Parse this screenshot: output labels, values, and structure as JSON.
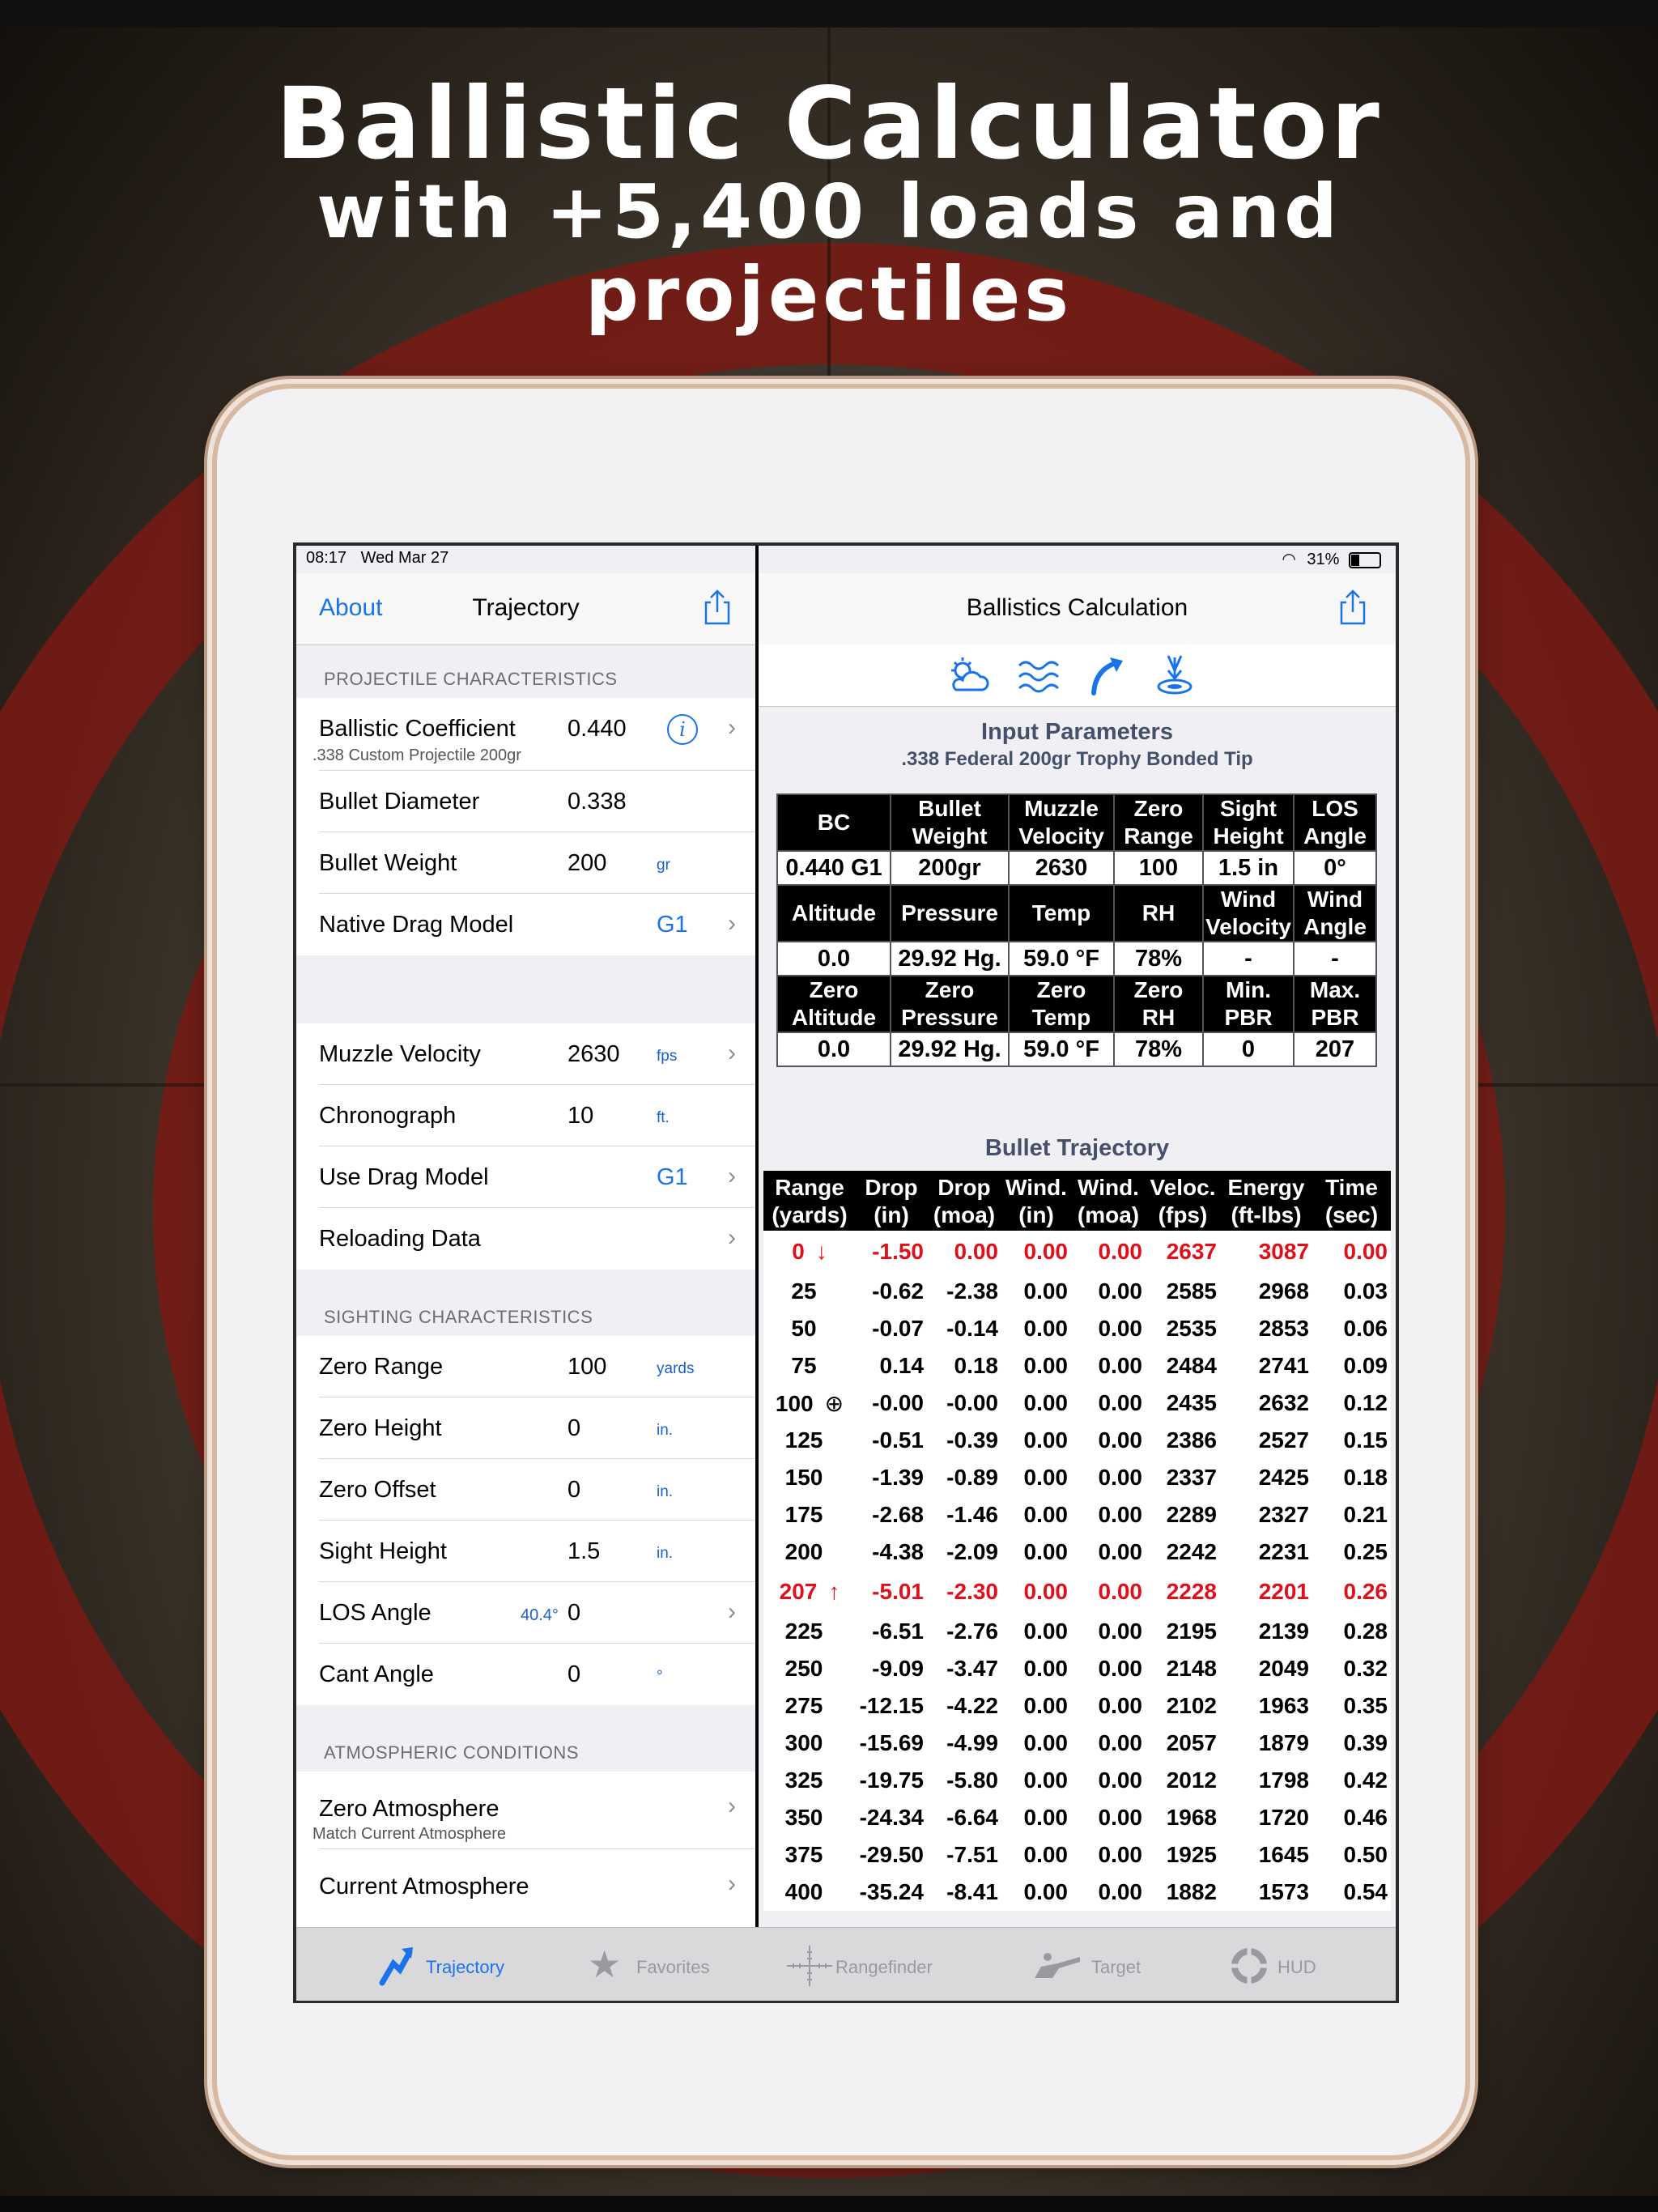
{
  "headline": {
    "line1": "Ballistic Calculator",
    "line2": "with +5,400 loads and",
    "line3": "projectiles"
  },
  "status": {
    "time": "08:17",
    "date": "Wed Mar 27",
    "battery": "31%"
  },
  "left_nav": {
    "back": "About",
    "title": "Trajectory"
  },
  "right_nav": {
    "title": "Ballistics Calculation"
  },
  "projectile": {
    "header": "PROJECTILE CHARACTERISTICS",
    "bc_label": "Ballistic Coefficient",
    "bc_value": "0.440",
    "bc_sub": ".338 Custom Projectile 200gr",
    "diameter_label": "Bullet Diameter",
    "diameter_value": "0.338",
    "weight_label": "Bullet Weight",
    "weight_value": "200",
    "weight_unit": "gr",
    "native_drag_label": "Native Drag Model",
    "native_drag_value": "G1",
    "muzzle_label": "Muzzle Velocity",
    "muzzle_value": "2630",
    "muzzle_unit": "fps",
    "chrono_label": "Chronograph",
    "chrono_value": "10",
    "chrono_unit": "ft.",
    "use_drag_label": "Use Drag Model",
    "use_drag_value": "G1",
    "reloading_label": "Reloading Data"
  },
  "sighting": {
    "header": "SIGHTING CHARACTERISTICS",
    "zero_range_label": "Zero Range",
    "zero_range_value": "100",
    "zero_range_unit": "yards",
    "zero_height_label": "Zero Height",
    "zero_height_value": "0",
    "zero_height_unit": "in.",
    "zero_offset_label": "Zero Offset",
    "zero_offset_value": "0",
    "zero_offset_unit": "in.",
    "sight_height_label": "Sight Height",
    "sight_height_value": "1.5",
    "sight_height_unit": "in.",
    "los_label": "LOS Angle",
    "los_hint": "40.4°",
    "los_value": "0",
    "cant_label": "Cant Angle",
    "cant_value": "0",
    "cant_unit": "°"
  },
  "atmo": {
    "header": "ATMOSPHERIC CONDITIONS",
    "zero_label": "Zero Atmosphere",
    "zero_sub": "Match Current Atmosphere",
    "current_label": "Current Atmosphere"
  },
  "input_params": {
    "title": "Input Parameters",
    "subtitle": ".338 Federal 200gr Trophy Bonded Tip",
    "row1_headers": [
      "BC",
      "Bullet Weight",
      "Muzzle Velocity",
      "Zero Range",
      "Sight Height",
      "LOS Angle"
    ],
    "row1_values": [
      "0.440 G1",
      "200gr",
      "2630",
      "100",
      "1.5 in",
      "0°"
    ],
    "row2_headers": [
      "Altitude",
      "Pressure",
      "Temp",
      "RH",
      "Wind Velocity",
      "Wind Angle"
    ],
    "row2_values": [
      "0.0",
      "29.92 Hg.",
      "59.0 °F",
      "78%",
      "-",
      "-"
    ],
    "row3_headers": [
      "Zero Altitude",
      "Zero Pressure",
      "Zero Temp",
      "Zero RH",
      "Min. PBR",
      "Max. PBR"
    ],
    "row3_values": [
      "0.0",
      "29.92 Hg.",
      "59.0 °F",
      "78%",
      "0",
      "207"
    ]
  },
  "trajectory": {
    "title": "Bullet Trajectory",
    "headers": [
      "Range (yards)",
      "Drop (in)",
      "Drop (moa)",
      "Wind. (in)",
      "Wind. (moa)",
      "Veloc. (fps)",
      "Energy (ft-lbs)",
      "Time (sec)"
    ],
    "rows": [
      {
        "range": "0",
        "marker": "↓",
        "highlight": true,
        "cells": [
          "-1.50",
          "0.00",
          "0.00",
          "0.00",
          "2637",
          "3087",
          "0.00"
        ]
      },
      {
        "range": "25",
        "marker": "",
        "highlight": false,
        "cells": [
          "-0.62",
          "-2.38",
          "0.00",
          "0.00",
          "2585",
          "2968",
          "0.03"
        ]
      },
      {
        "range": "50",
        "marker": "",
        "highlight": false,
        "cells": [
          "-0.07",
          "-0.14",
          "0.00",
          "0.00",
          "2535",
          "2853",
          "0.06"
        ]
      },
      {
        "range": "75",
        "marker": "",
        "highlight": false,
        "cells": [
          "0.14",
          "0.18",
          "0.00",
          "0.00",
          "2484",
          "2741",
          "0.09"
        ]
      },
      {
        "range": "100",
        "marker": "⊕",
        "highlight": false,
        "cells": [
          "-0.00",
          "-0.00",
          "0.00",
          "0.00",
          "2435",
          "2632",
          "0.12"
        ]
      },
      {
        "range": "125",
        "marker": "",
        "highlight": false,
        "cells": [
          "-0.51",
          "-0.39",
          "0.00",
          "0.00",
          "2386",
          "2527",
          "0.15"
        ]
      },
      {
        "range": "150",
        "marker": "",
        "highlight": false,
        "cells": [
          "-1.39",
          "-0.89",
          "0.00",
          "0.00",
          "2337",
          "2425",
          "0.18"
        ]
      },
      {
        "range": "175",
        "marker": "",
        "highlight": false,
        "cells": [
          "-2.68",
          "-1.46",
          "0.00",
          "0.00",
          "2289",
          "2327",
          "0.21"
        ]
      },
      {
        "range": "200",
        "marker": "",
        "highlight": false,
        "cells": [
          "-4.38",
          "-2.09",
          "0.00",
          "0.00",
          "2242",
          "2231",
          "0.25"
        ]
      },
      {
        "range": "207",
        "marker": "↑",
        "highlight": true,
        "cells": [
          "-5.01",
          "-2.30",
          "0.00",
          "0.00",
          "2228",
          "2201",
          "0.26"
        ]
      },
      {
        "range": "225",
        "marker": "",
        "highlight": false,
        "cells": [
          "-6.51",
          "-2.76",
          "0.00",
          "0.00",
          "2195",
          "2139",
          "0.28"
        ]
      },
      {
        "range": "250",
        "marker": "",
        "highlight": false,
        "cells": [
          "-9.09",
          "-3.47",
          "0.00",
          "0.00",
          "2148",
          "2049",
          "0.32"
        ]
      },
      {
        "range": "275",
        "marker": "",
        "highlight": false,
        "cells": [
          "-12.15",
          "-4.22",
          "0.00",
          "0.00",
          "2102",
          "1963",
          "0.35"
        ]
      },
      {
        "range": "300",
        "marker": "",
        "highlight": false,
        "cells": [
          "-15.69",
          "-4.99",
          "0.00",
          "0.00",
          "2057",
          "1879",
          "0.39"
        ]
      },
      {
        "range": "325",
        "marker": "",
        "highlight": false,
        "cells": [
          "-19.75",
          "-5.80",
          "0.00",
          "0.00",
          "2012",
          "1798",
          "0.42"
        ]
      },
      {
        "range": "350",
        "marker": "",
        "highlight": false,
        "cells": [
          "-24.34",
          "-6.64",
          "0.00",
          "0.00",
          "1968",
          "1720",
          "0.46"
        ]
      },
      {
        "range": "375",
        "marker": "",
        "highlight": false,
        "cells": [
          "-29.50",
          "-7.51",
          "0.00",
          "0.00",
          "1925",
          "1645",
          "0.50"
        ]
      },
      {
        "range": "400",
        "marker": "",
        "highlight": false,
        "cells": [
          "-35.24",
          "-8.41",
          "0.00",
          "0.00",
          "1882",
          "1573",
          "0.54"
        ]
      }
    ]
  },
  "tabs": {
    "trajectory": "Trajectory",
    "favorites": "Favorites",
    "rangefinder": "Rangefinder",
    "target": "Target",
    "hud": "HUD"
  },
  "colors": {
    "accent": "#1a73e8",
    "highlight": "#e0101a",
    "target_red": "#8a1a14"
  }
}
